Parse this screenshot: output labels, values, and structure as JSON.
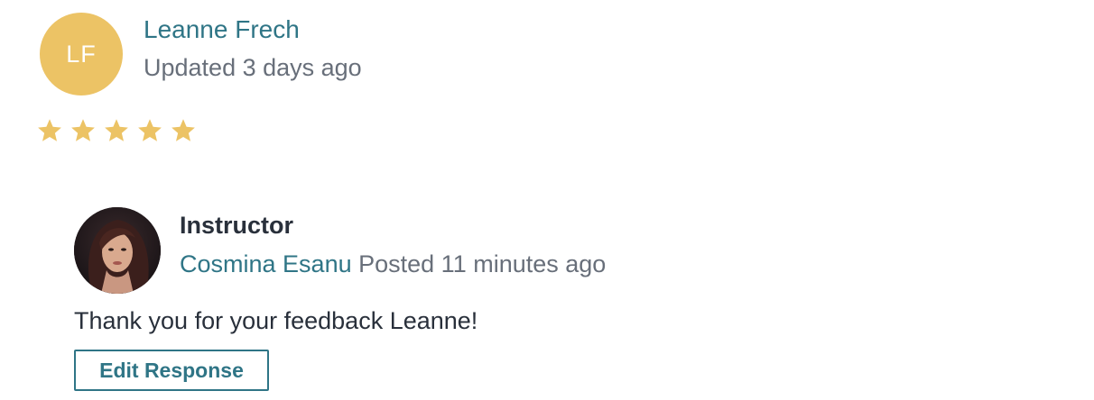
{
  "review": {
    "reviewer": {
      "initials": "LF",
      "name": "Leanne Frech",
      "updated": "Updated 3 days ago",
      "avatar_color": "#ecc365"
    },
    "rating": {
      "value": 5,
      "max": 5,
      "star_color": "#ecc365",
      "icon": "star-icon"
    }
  },
  "response": {
    "role": "Instructor",
    "instructor_name": "Cosmina Esanu",
    "posted": "Posted 11 minutes ago",
    "text": "Thank you for your feedback Leanne!",
    "edit_label": "Edit Response"
  },
  "colors": {
    "link": "#2f7586",
    "muted": "#686f7a",
    "text": "#29303b"
  }
}
